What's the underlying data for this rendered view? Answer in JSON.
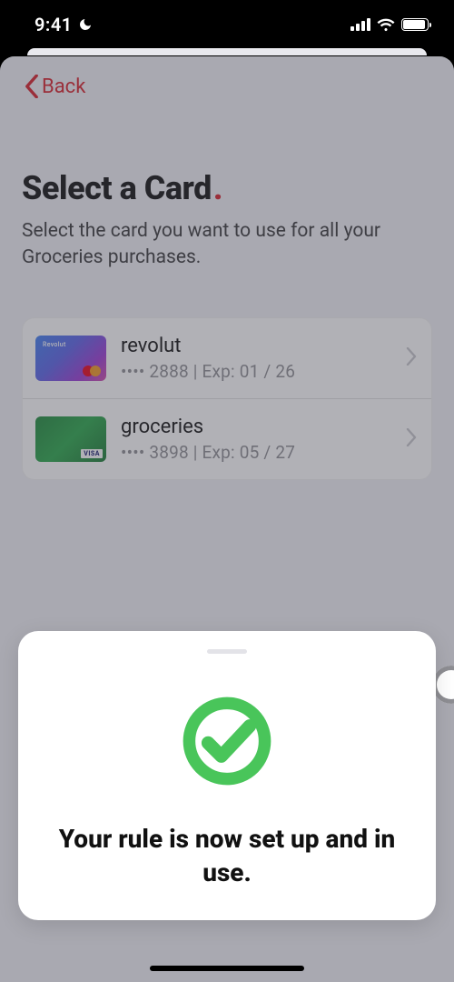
{
  "status": {
    "time": "9:41"
  },
  "nav": {
    "back_label": "Back"
  },
  "heading": {
    "title": "Select a Card",
    "dot": ".",
    "subtitle": "Select the card you want to use for all your Groceries purchases."
  },
  "cards": [
    {
      "name": "revolut",
      "meta": "•••• 2888 | Exp: 01 / 26",
      "thumb_brand": "Revolut",
      "network": "mastercard"
    },
    {
      "name": "groceries",
      "meta": "•••• 3898 | Exp: 05 / 27",
      "thumb_brand": "",
      "network": "visa",
      "visa_label": "VISA"
    }
  ],
  "modal": {
    "message": "Your rule is now set up and in use."
  }
}
